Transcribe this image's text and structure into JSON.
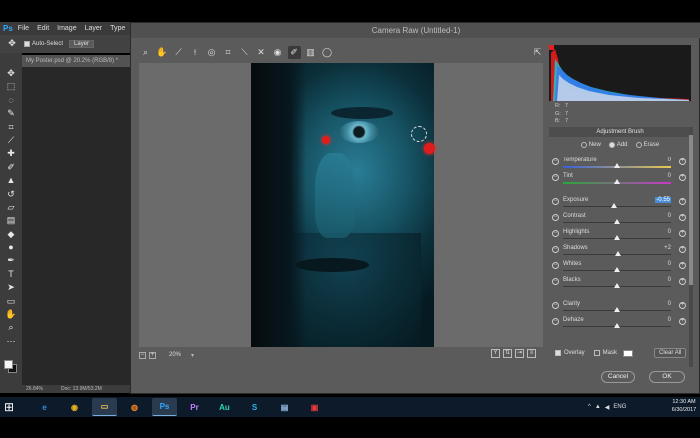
{
  "photoshop": {
    "logo": "Ps",
    "menu": [
      "File",
      "Edit",
      "Image",
      "Layer",
      "Type"
    ],
    "options_bar": {
      "auto_select_label": "Auto-Select",
      "layer_select": "Layer"
    },
    "document_tab": "My Poster.psd @ 20.2% (RGB/8) *",
    "status": {
      "zoom": "26.84%",
      "doc_info": "Doc: 13.9M/53.2M"
    }
  },
  "camera_raw": {
    "title": "Camera Raw (Untitled-1)",
    "histogram_readout": [
      {
        "channel": "R:",
        "value": "7"
      },
      {
        "channel": "G:",
        "value": "7"
      },
      {
        "channel": "B:",
        "value": "7"
      }
    ],
    "panel_title": "Adjustment Brush",
    "modes": {
      "new": "New",
      "add": "Add",
      "erase": "Erase",
      "selected": "add"
    },
    "adjustments": [
      {
        "key": "temperature",
        "label": "Temperature",
        "value": "0",
        "level": 0.5,
        "track": "temp"
      },
      {
        "key": "tint",
        "label": "Tint",
        "value": "0",
        "level": 0.5,
        "track": "tint"
      },
      {
        "key": "exposure",
        "label": "Exposure",
        "value": "-0.55",
        "level": 0.47,
        "track": "",
        "highlighted": true
      },
      {
        "key": "contrast",
        "label": "Contrast",
        "value": "0",
        "level": 0.5,
        "track": ""
      },
      {
        "key": "highlights",
        "label": "Highlights",
        "value": "0",
        "level": 0.5,
        "track": ""
      },
      {
        "key": "shadows",
        "label": "Shadows",
        "value": "+2",
        "level": 0.51,
        "track": ""
      },
      {
        "key": "whites",
        "label": "Whites",
        "value": "0",
        "level": 0.5,
        "track": ""
      },
      {
        "key": "blacks",
        "label": "Blacks",
        "value": "0",
        "level": 0.5,
        "track": ""
      },
      {
        "key": "clarity",
        "label": "Clarity",
        "value": "0",
        "level": 0.5,
        "track": ""
      },
      {
        "key": "dehaze",
        "label": "Dehaze",
        "value": "0",
        "level": 0.5,
        "track": ""
      }
    ],
    "overlay_label": "Overlay",
    "mask_label": "Mask",
    "clear_all_label": "Clear All",
    "zoom_level": "20%",
    "cancel_label": "Cancel",
    "ok_label": "OK"
  },
  "taskbar": {
    "icons": [
      {
        "name": "internet-explorer-icon",
        "glyph": "e",
        "color": "#2d8fe0",
        "active": false
      },
      {
        "name": "chrome-icon",
        "glyph": "◉",
        "color": "#e8b020",
        "active": false
      },
      {
        "name": "file-explorer-icon",
        "glyph": "▭",
        "color": "#f0c850",
        "active": true
      },
      {
        "name": "firefox-icon",
        "glyph": "◍",
        "color": "#f08020",
        "active": false
      },
      {
        "name": "photoshop-icon",
        "glyph": "Ps",
        "color": "#31a8ff",
        "active": true
      },
      {
        "name": "premiere-icon",
        "glyph": "Pr",
        "color": "#c080ff",
        "active": false
      },
      {
        "name": "audition-icon",
        "glyph": "Au",
        "color": "#30d8a8",
        "active": false
      },
      {
        "name": "skype-icon",
        "glyph": "S",
        "color": "#30b0f0",
        "active": false
      },
      {
        "name": "network-drive-icon",
        "glyph": "▤",
        "color": "#9ac0e8",
        "active": false
      },
      {
        "name": "red-app-icon",
        "glyph": "▣",
        "color": "#e83838",
        "active": false
      }
    ],
    "language": "ENG",
    "time": "12:30 AM",
    "date": "6/30/2017"
  }
}
